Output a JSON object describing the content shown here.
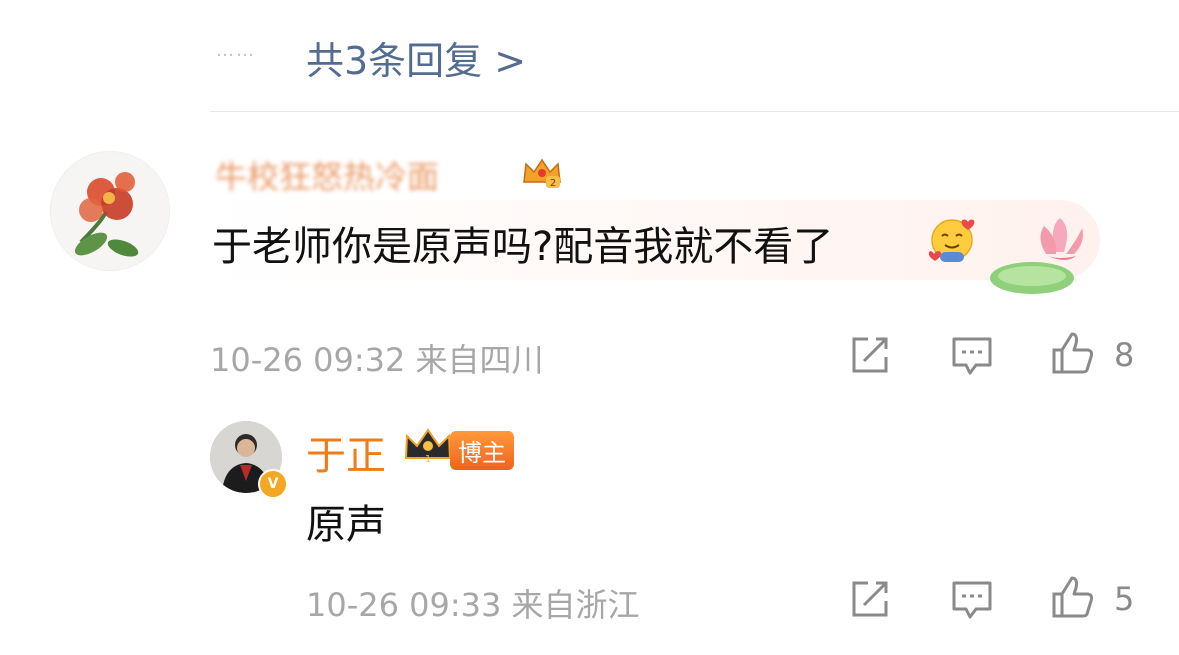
{
  "thread": {
    "dots": "……",
    "replies_link": "共3条回复 >"
  },
  "comment1": {
    "author_blurred": "牛校狂怒热冷面",
    "text": "于老师你是原声吗?配音我就不看了",
    "emoji_icon": "shy-heart-emoji-icon",
    "decoration_icon": "lotus-sticker-icon",
    "crown_level": "2",
    "time": "10-26 09:32",
    "location": "来自四川",
    "likes": "8"
  },
  "comment2": {
    "author": "于正",
    "badge": "博主",
    "crown_level": "1",
    "verified_mark": "V",
    "text": "原声",
    "time": "10-26 09:33",
    "location": "来自浙江",
    "likes": "5"
  },
  "colors": {
    "link": "#546c92",
    "meta": "#a7a7a7",
    "author_orange": "#ef7b19",
    "host_badge": "#f0631b"
  }
}
